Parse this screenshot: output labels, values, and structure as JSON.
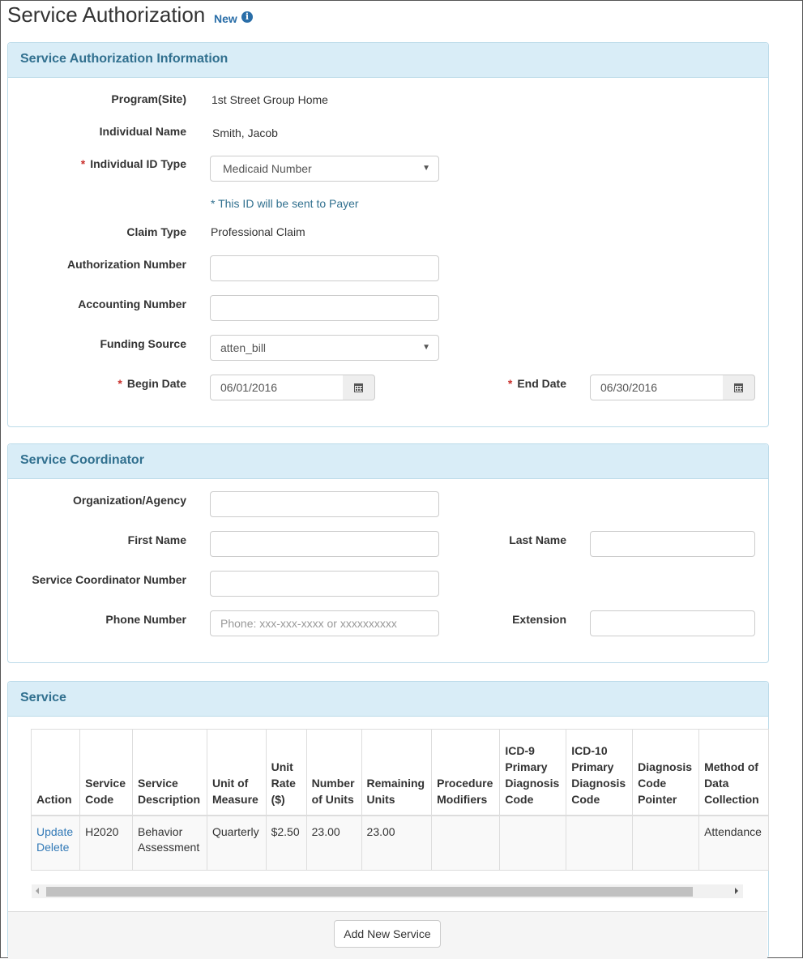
{
  "page": {
    "title": "Service Authorization",
    "badge": "New",
    "info_icon": "info-icon"
  },
  "auth_panel": {
    "heading": "Service Authorization Information",
    "program_label": "Program(Site)",
    "program_value": "1st Street Group Home",
    "name_label": "Individual Name",
    "name_value": "Smith, Jacob",
    "id_type_label": "Individual ID Type",
    "id_type_value": "Medicaid Number",
    "id_hint": "* This ID will be sent to Payer",
    "claim_label": "Claim Type",
    "claim_value": "Professional Claim",
    "auth_num_label": "Authorization Number",
    "auth_num_value": "",
    "acct_num_label": "Accounting Number",
    "acct_num_value": "",
    "funding_label": "Funding Source",
    "funding_value": "atten_bill",
    "begin_label": "Begin Date",
    "begin_value": "06/01/2016",
    "end_label": "End Date",
    "end_value": "06/30/2016",
    "required_mark": "*"
  },
  "coord_panel": {
    "heading": "Service Coordinator",
    "org_label": "Organization/Agency",
    "first_label": "First Name",
    "last_label": "Last Name",
    "coord_num_label": "Service Coordinator Number",
    "phone_label": "Phone Number",
    "phone_placeholder": "Phone: xxx-xxx-xxxx or xxxxxxxxxx",
    "ext_label": "Extension"
  },
  "service_panel": {
    "heading": "Service",
    "columns": [
      "Action",
      "Service Code",
      "Service Description",
      "Unit of Measure",
      "Unit Rate ($)",
      "Number of Units",
      "Remaining Units",
      "Procedure Modifiers",
      "ICD-9 Primary Diagnosis Code",
      "ICD-10 Primary Diagnosis Code",
      "Diagnosis Code Pointer",
      "Method of Data Collection"
    ],
    "rows": [
      {
        "update": "Update",
        "delete": "Delete",
        "code": "H2020",
        "description": "Behavior Assessment",
        "unit": "Quarterly",
        "rate": "$2.50",
        "units": "23.00",
        "remaining": "23.00",
        "modifiers": "",
        "icd9": "",
        "icd10": "",
        "pointer": "",
        "method": "Attendance"
      }
    ],
    "add_button": "Add New Service"
  }
}
